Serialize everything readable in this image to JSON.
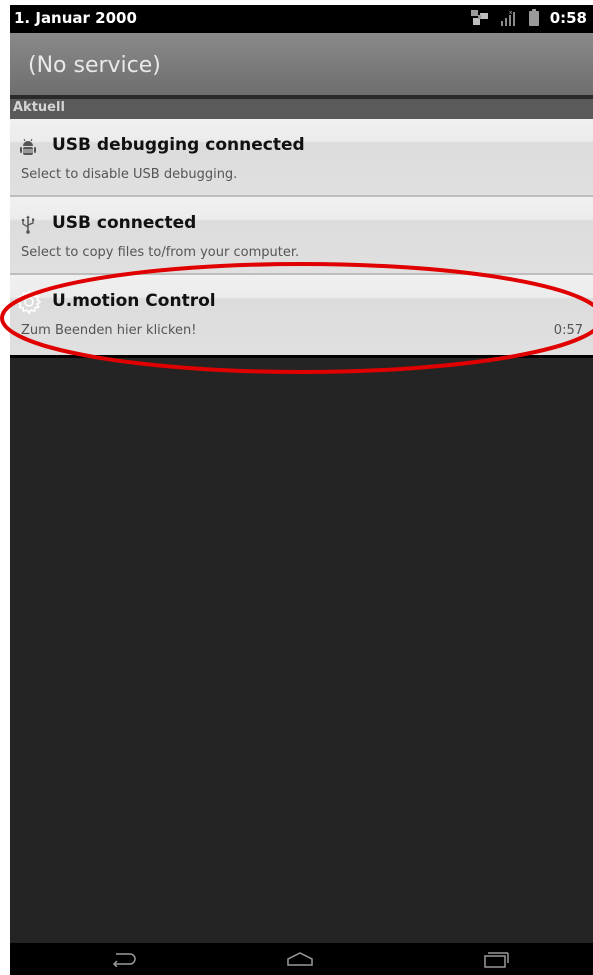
{
  "status_bar": {
    "date": "1. Januar 2000",
    "time": "0:58",
    "icons": [
      "usb-tether-icon",
      "signal-icon",
      "battery-icon"
    ]
  },
  "carrier": {
    "label": "(No service)"
  },
  "section": {
    "label": "Aktuell"
  },
  "notifications": [
    {
      "icon": "android-bug-icon",
      "title": "USB debugging connected",
      "text": "Select to disable USB debugging.",
      "time": ""
    },
    {
      "icon": "usb-icon",
      "title": "USB connected",
      "text": "Select to copy files to/from your computer.",
      "time": ""
    },
    {
      "icon": "gear-icon",
      "title": "U.motion Control",
      "text": "Zum Beenden hier klicken!",
      "time": "0:57"
    }
  ],
  "nav": {
    "icons": [
      "back-icon",
      "home-icon",
      "recents-icon"
    ]
  },
  "colors": {
    "annotation": "#e00000",
    "header_bg": "#7c7c7c",
    "list_bg": "#e0e0e0",
    "empty_bg": "#242424"
  }
}
